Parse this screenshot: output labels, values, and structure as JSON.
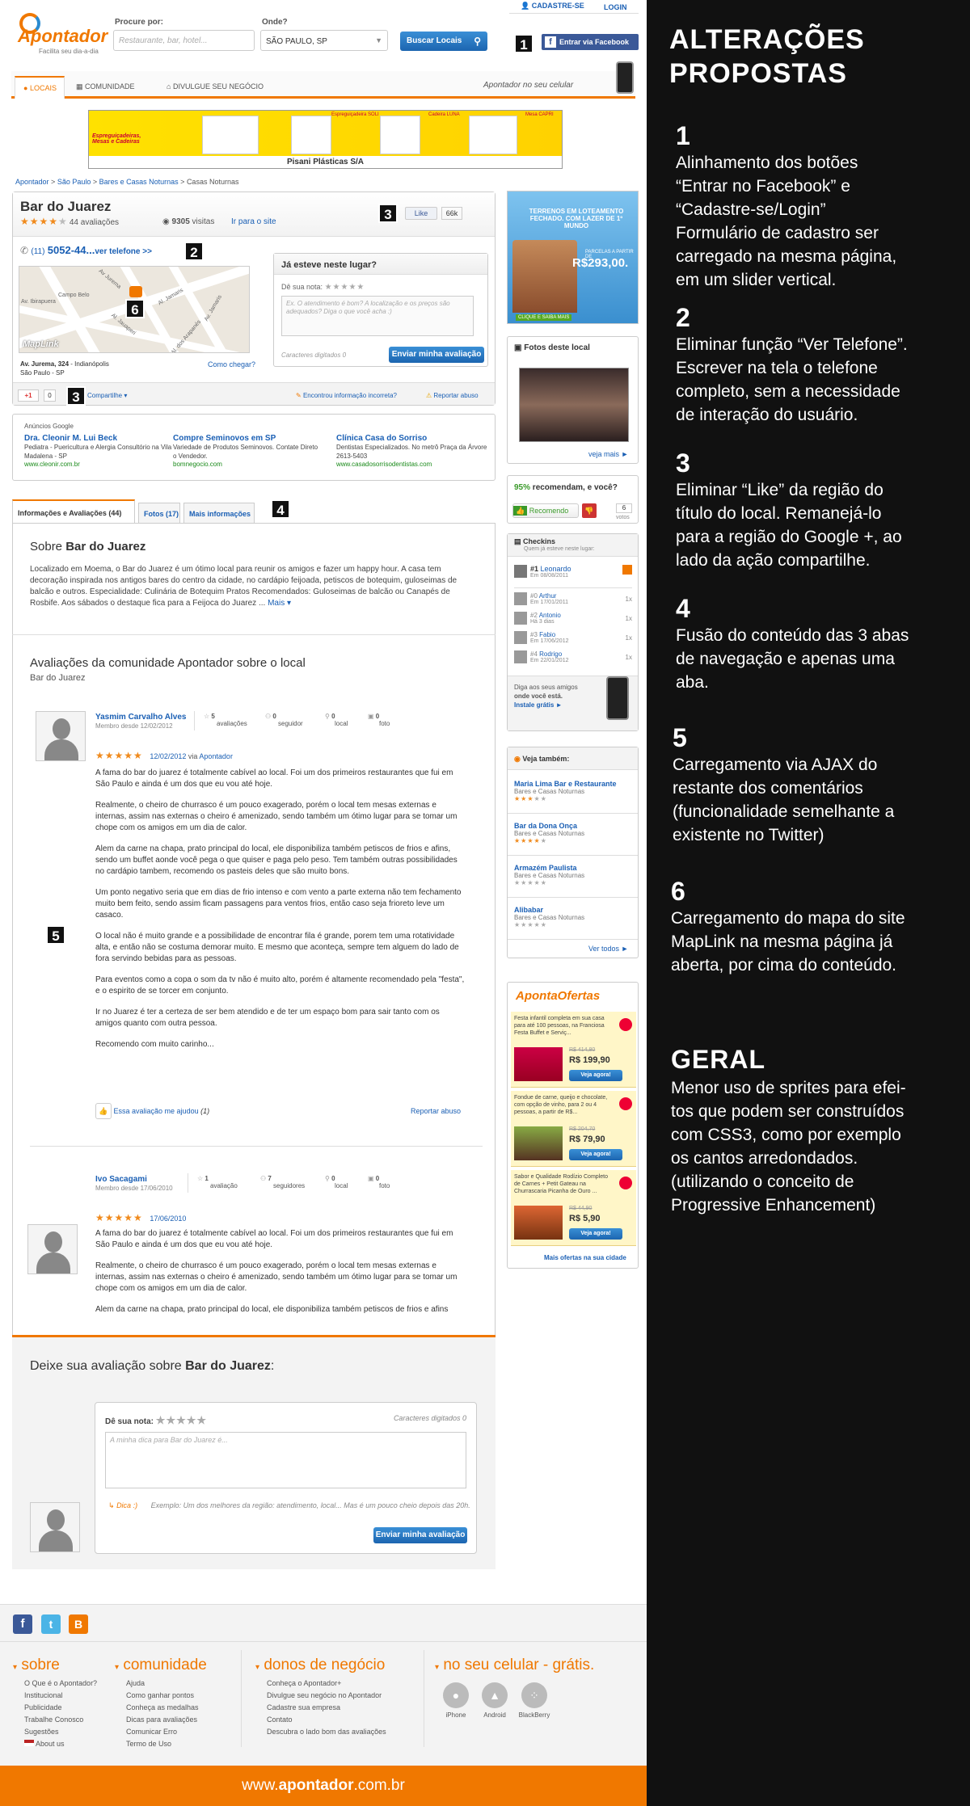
{
  "header": {
    "logo": "Apontador",
    "logo_tagline": "Facilita seu dia-a-dia",
    "search_label": "Procure por:",
    "search_placeholder": "Restaurante, bar, hotel...",
    "where_label": "Onde?",
    "where_value": "SÃO PAULO, SP",
    "search_button": "Buscar Locais",
    "signup": "CADASTRE-SE",
    "login": "LOGIN",
    "facebook": "Entrar via Facebook"
  },
  "nav": {
    "tabs": [
      "LOCAIS",
      "COMUNIDADE",
      "DIVULGUE SEU NEGÓCIO"
    ],
    "mobile_promo": "Apontador no seu celular"
  },
  "banner": {
    "company": "Pisani Plásticas S/A",
    "left_text": "Espreguiçadeiras, Mesas e Cadeiras",
    "labels": [
      "Espreguiçadeira SOLI",
      "Cadeira LUNA",
      "Mesa CAPRI"
    ]
  },
  "breadcrumb": [
    "Apontador",
    "São Paulo",
    "Bares e Casas Noturnas",
    "Casas Noturnas"
  ],
  "place": {
    "name": "Bar do Juarez",
    "rating_stars": 4,
    "reviews": "44 avaliações",
    "visits_count": "9305",
    "visits_label": "visitas",
    "site_link": "Ir para o site",
    "like": "Like",
    "like_count": "66k",
    "phone_prefix": "(11)",
    "phone": "5052-44...",
    "phone_link": "ver telefone >>",
    "address_1": "Av. Jurema, 324",
    "address_1b": " - Indianópolis",
    "address_2": "São Paulo - SP",
    "how_to": "Como chegar?",
    "map_logo": "MapLink",
    "map_streets": [
      "Av Jurema",
      "Al. Jamaris",
      "Av. Ibirapuera",
      "Al. Jauaperi",
      "Av. Jamaris",
      "Al. dos Arapanés",
      "Campo Belo"
    ],
    "gplus": "+1",
    "gplus_count": "0",
    "share": "Compartilhe ▾",
    "report_info": "Encontrou informação incorreta?",
    "report_abuse": "Reportar abuso"
  },
  "quick_review": {
    "title": "Já esteve neste lugar?",
    "rate_label": "Dê sua nota:",
    "placeholder": "Ex. O atendimento é bom? A localização e os preços são adequados? Diga o que você acha :)",
    "counter": "Caracteres digitados 0",
    "submit": "Enviar minha avaliação"
  },
  "google_ads": {
    "label": "Anúncios Google",
    "ads": [
      {
        "title": "Dra. Cleonir M. Lui Beck",
        "text": "Pediatra - Puericultura e Alergia Consultório na Vila Madalena - SP",
        "url": "www.cleonir.com.br"
      },
      {
        "title": "Compre Seminovos em SP",
        "text": "Variedade de Produtos Seminovos. Contate Direto o Vendedor.",
        "url": "bomnegocio.com"
      },
      {
        "title": "Clínica Casa do Sorriso",
        "text": "Dentistas Especializados. No metrô Praça da Árvore 2613-5403",
        "url": "www.casadosorrisodentistas.com"
      }
    ]
  },
  "tabs": [
    "Informações e Avaliações (44)",
    "Fotos (17)",
    "Mais informações"
  ],
  "about": {
    "title_prefix": "Sobre ",
    "title_name": "Bar do Juarez",
    "text": "Localizado em Moema, o Bar do Juarez é um ótimo local para reunir os amigos e fazer um happy hour. A casa tem decoração inspirada nos antigos bares do centro da cidade, no cardápio feijoada, petiscos de botequim, guloseimas de balcão e outros. Especialidade: Culinária de Botequim Pratos Recomendados: Guloseimas de balcão ou Canapés de Rosbife. Aos sábados o destaque fica para a Feijoca do Juarez ...",
    "more": "Mais ▾"
  },
  "reviews_section": {
    "title": "Avaliações da comunidade Apontador sobre o local",
    "subtitle": "Bar do Juarez",
    "reviews": [
      {
        "name": "Yasmim Carvalho Alves",
        "since": "Membro desde 12/02/2012",
        "stats": [
          [
            "5",
            "avaliações"
          ],
          [
            "0",
            "seguidor"
          ],
          [
            "0",
            "local"
          ],
          [
            "0",
            "foto"
          ]
        ],
        "date": "12/02/2012",
        "via": "via",
        "via_link": "Apontador",
        "paragraphs": [
          "A fama do bar do juarez é totalmente cabível ao local. Foi um dos primeiros restaurantes que fui em São Paulo e ainda é um dos que eu vou até hoje.",
          "Realmente, o cheiro de churrasco é um pouco exagerado, porém o local tem mesas externas e internas, assim nas externas o cheiro é amenizado, sendo também um ótimo lugar para se tomar um chope com os amigos em um dia de calor.",
          "Alem da carne na chapa, prato principal do local, ele disponibiliza também petiscos de frios e afins, sendo um buffet aonde você pega o que quiser e paga pelo peso. Tem também outras possibilidades no cardápio tambem, recomendo os pasteis deles que são muito bons.",
          "Um ponto negativo seria que em dias de frio intenso e com vento a parte externa não tem fechamento muito bem feito, sendo assim ficam passagens para ventos frios, então caso seja frioreto leve um casaco.",
          "O local não é muito grande e a possibilidade de encontrar fila é grande, porem tem uma rotatividade alta, e então não se costuma demorar muito. E mesmo que aconteça, sempre tem alguem do lado de fora servindo bebidas para as pessoas.",
          "Para eventos como a copa o som da tv não é muito alto, porém é altamente recomendado pela \"festa\", e o espirito de se torcer em conjunto.",
          "Ir no Juarez é ter a certeza de ser bem atendido e de ter um espaço bom para sair tanto com os amigos quanto com outra pessoa.",
          "Recomendo com muito carinho..."
        ],
        "helpful": "Essa avaliação me ajudou",
        "helpful_count": "(1)",
        "report": "Reportar abuso"
      },
      {
        "name": "Ivo Sacagami",
        "since": "Membro desde 17/06/2010",
        "stats": [
          [
            "1",
            "avaliação"
          ],
          [
            "7",
            "seguidores"
          ],
          [
            "0",
            "local"
          ],
          [
            "0",
            "foto"
          ]
        ],
        "date": "17/06/2010",
        "paragraphs": [
          "A fama do bar do juarez é totalmente cabível ao local. Foi um dos primeiros restaurantes que fui em São Paulo e ainda é um dos que eu vou até hoje.",
          "Realmente, o cheiro de churrasco é um pouco exagerado, porém o local tem mesas externas e internas, assim nas externas o cheiro é amenizado, sendo também um ótimo lugar para se tomar um chope com os amigos em um dia de calor.",
          "Alem da carne na chapa, prato principal do local, ele disponibiliza também petiscos de frios e afins"
        ]
      }
    ]
  },
  "leave_review": {
    "title_prefix": "Deixe sua avaliação sobre ",
    "title_name": "Bar do Juarez",
    "title_suffix": ":",
    "rate_label": "Dê sua nota:",
    "counter": "Caracteres digitados 0",
    "placeholder": "A minha dica para Bar do Juarez é...",
    "tip": "Dica :)",
    "example": "Exemplo: Um dos melhores da região: atendimento, local... Mas é um pouco cheio depois das 20h.",
    "submit": "Enviar minha avaliação"
  },
  "sidebar": {
    "ad_lines": [
      "TERRENOS EM LOTEAMENTO FECHADO. COM LAZER DE 1º MUNDO",
      "PARCELAS A PARTIR DE",
      "R$293,00.",
      "CLIQUE E SAIBA MAIS"
    ],
    "photos_title": "Fotos deste local",
    "photos_more": "veja mais ►",
    "recommend_pct": "95%",
    "recommend_text": "recomendam, e você?",
    "recommend_button": "Recomendo",
    "votes_count": "6",
    "votes_label": "votos",
    "checkins_title": "Checkins",
    "checkins_sub": "Quem já esteve neste lugar:",
    "checkins": [
      {
        "rank": "#1",
        "name": "Leonardo",
        "date": "Em 08/08/2011",
        "count": ""
      },
      {
        "rank": "#0",
        "name": "Arthur",
        "date": "Em 17/01/2011",
        "count": "1x"
      },
      {
        "rank": "#2",
        "name": "Antonio",
        "date": "Há 3 dias",
        "count": "1x"
      },
      {
        "rank": "#3",
        "name": "Fabio",
        "date": "Em 17/06/2012",
        "count": "1x"
      },
      {
        "rank": "#4",
        "name": "Rodrigo",
        "date": "Em 22/01/2012",
        "count": "1x"
      }
    ],
    "checkin_promo_1": "Diga aos seus amigos",
    "checkin_promo_2": "onde você está.",
    "checkin_promo_3": "Instale grátis ►",
    "see_also_title": "Veja também:",
    "see_also": [
      {
        "name": "Maria Lima Bar e Restaurante",
        "cat": "Bares e Casas Noturnas"
      },
      {
        "name": "Bar da Dona Onça",
        "cat": "Bares e Casas Noturnas"
      },
      {
        "name": "Armazém Paulista",
        "cat": "Bares e Casas Noturnas"
      },
      {
        "name": "Alibabar",
        "cat": "Bares e Casas Noturnas"
      }
    ],
    "see_all": "Ver todos ►",
    "offers_title": "ApontaOfertas",
    "offers": [
      {
        "text": "Festa infantil completa em sua casa para até 100 pessoas, na Franciosa Festa Buffet e Serviç...",
        "old": "R$ 414,80",
        "price": "R$ 199,90",
        "button": "Veja agora!"
      },
      {
        "text": "Fondue de carne, queijo e chocolate, com opção de vinho, para 2 ou 4 pessoas, a partir de R$...",
        "old": "R$ 204,70",
        "price": "R$ 79,90",
        "button": "Veja agora!"
      },
      {
        "text": "Sabor e Qualidade Rodízio Completo de Carnes + Petit Gateau na Churrascaria Picanha de Ouro ...",
        "old": "R$ 44,90",
        "price": "R$ 5,90",
        "button": "Veja agora!"
      }
    ],
    "offers_more": "Mais ofertas na sua cidade"
  },
  "footer": {
    "cols": [
      {
        "title": "sobre",
        "items": [
          "O Que é o Apontador?",
          "Institucional",
          "Publicidade",
          "Trabalhe Conosco",
          "Sugestões",
          "About us"
        ]
      },
      {
        "title": "comunidade",
        "items": [
          "Ajuda",
          "Como ganhar pontos",
          "Conheça as medalhas",
          "Dicas para avaliações",
          "Comunicar Erro",
          "Termo de Uso"
        ]
      },
      {
        "title": "donos de negócio",
        "items": [
          "Conheça o Apontador+",
          "Divulgue seu negócio no Apontador",
          "Cadastre sua empresa",
          "Contato",
          "Descubra o lado bom das avaliações"
        ]
      },
      {
        "title": "no seu celular - grátis.",
        "items": []
      }
    ],
    "apps": [
      "iPhone",
      "Android",
      "BlackBerry"
    ],
    "domain_pre": "www.",
    "domain_main": "apontador",
    "domain_post": ".com.br"
  },
  "notes": {
    "title_1": "ALTERAÇÕES",
    "title_2": "PROPOSTAS",
    "items": [
      {
        "n": "1",
        "lines": [
          "Alinhamento dos botões",
          "“Entrar no Facebook” e",
          "“Cadastre-se/Login”",
          "Formulário de cadastro ser",
          "carregado na mesma página,",
          "em um slider vertical."
        ]
      },
      {
        "n": "2",
        "lines": [
          "Eliminar função “Ver Telefone”.",
          "Escrever na tela o telefone",
          "completo, sem a necessidade",
          "de interação do usuário."
        ]
      },
      {
        "n": "3",
        "lines": [
          "Eliminar “Like” da região do",
          "título do local. Remanejá-lo",
          "para a região do Google +, ao",
          "lado da ação compartilhe."
        ]
      },
      {
        "n": "4",
        "lines": [
          "Fusão do conteúdo das 3 abas",
          "de navegação e apenas uma",
          "aba."
        ]
      },
      {
        "n": "5",
        "lines": [
          "Carregamento via AJAX do",
          "restante dos comentários",
          "(funcionalidade semelhante a",
          "existente no Twitter)"
        ]
      },
      {
        "n": "6",
        "lines": [
          "Carregamento do mapa do site",
          "MapLink na mesma página já",
          "aberta, por cima do conteúdo."
        ]
      }
    ],
    "general_title": "GERAL",
    "general_lines": [
      "Menor uso de sprites para efei-",
      "tos que podem ser construídos",
      "com CSS3, como por exemplo",
      "os cantos arredondados.",
      "(utilizando o conceito de",
      "Progressive Enhancement)"
    ]
  },
  "markers": [
    "1",
    "2",
    "3",
    "3",
    "4",
    "5",
    "6"
  ],
  "colors": {
    "accent": "#f07800",
    "link": "#1a5fb4",
    "button": "#1c65b0",
    "facebook": "#3b5998"
  }
}
